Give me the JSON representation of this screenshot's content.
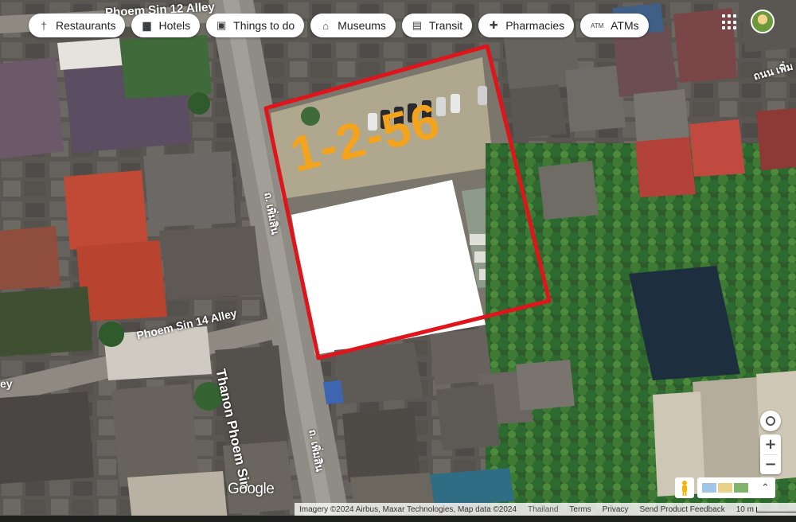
{
  "chips": [
    {
      "label": "Restaurants",
      "icon": "fork-knife-icon",
      "glyph": "†"
    },
    {
      "label": "Hotels",
      "icon": "bed-icon",
      "glyph": "▆"
    },
    {
      "label": "Things to do",
      "icon": "camera-icon",
      "glyph": "▣"
    },
    {
      "label": "Museums",
      "icon": "museum-icon",
      "glyph": "⌂"
    },
    {
      "label": "Transit",
      "icon": "bus-icon",
      "glyph": "▤"
    },
    {
      "label": "Pharmacies",
      "icon": "pharmacy-icon",
      "glyph": "✚"
    },
    {
      "label": "ATMs",
      "icon": "atm-icon",
      "glyph": "ATM"
    }
  ],
  "map_labels": {
    "street_top": "Phoem Sin 12 Alley",
    "street_main": "Thanon Phoem Sin",
    "street_alley14": "Phoem Sin 14 Alley",
    "thai_main_upper": "ถ. เพิ่มสิน",
    "thai_main_lower": "ถ. เพิ่มสิน",
    "thai_topright": "ถนน เพิ่ม",
    "edge_left": "ey"
  },
  "annotation": {
    "plot_code": "1-2-56",
    "outline_color": "#e0141b",
    "text_color": "#f4a31c"
  },
  "controls": {
    "zoom_in": "+",
    "zoom_out": "−",
    "expand": "⌃"
  },
  "brand": "Google",
  "footer": {
    "imagery": "Imagery ©2024 Airbus, Maxar Technologies, Map data ©2024",
    "country": "Thailand",
    "terms": "Terms",
    "privacy": "Privacy",
    "feedback": "Send Product Feedback",
    "scale": "10 m"
  }
}
